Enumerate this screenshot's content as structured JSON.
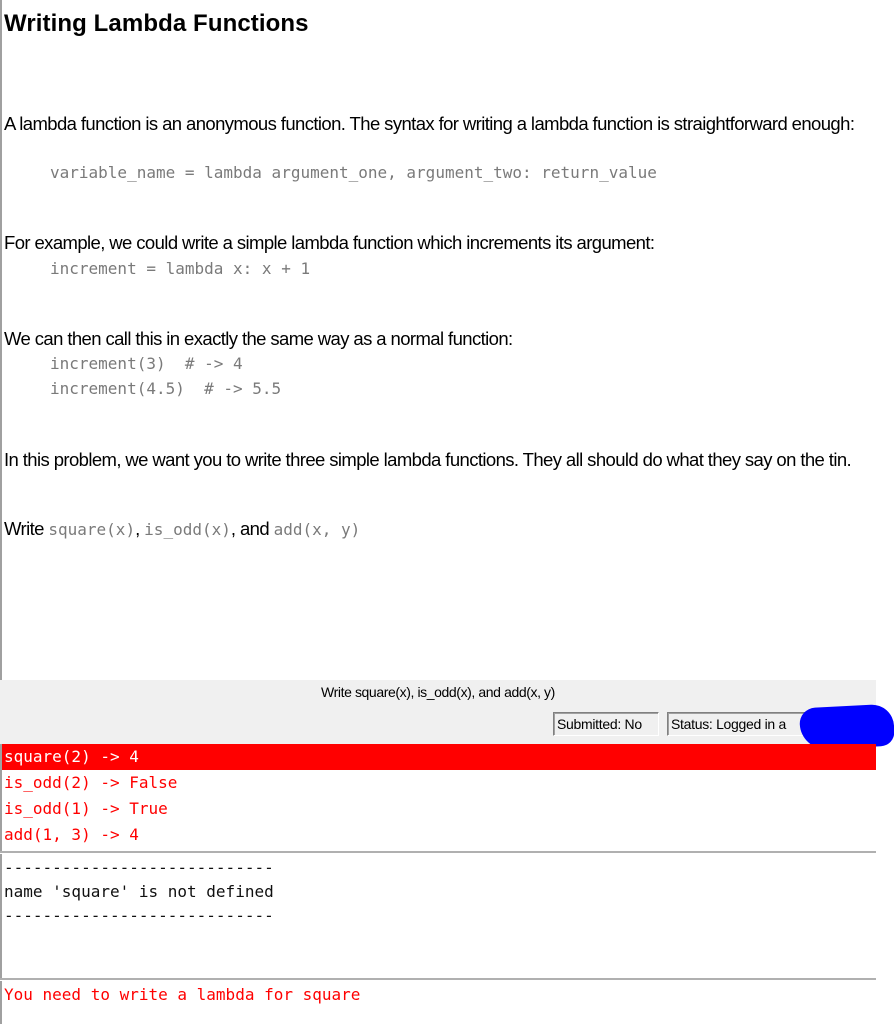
{
  "document": {
    "title": "Writing Lambda Functions",
    "paragraphs": {
      "intro": "A lambda function is an anonymous function. The syntax for writing a lambda function is straightforward enough:",
      "example": "For example, we could write a simple lambda function which increments its argument:",
      "call": "We can then call this in exactly the same way as a normal function:",
      "problem": "In this problem, we want you to write three simple lambda functions. They all should do what they say on the tin."
    },
    "code": {
      "syntax": "variable_name = lambda argument_one, argument_two: return_value",
      "increment_def": "increment = lambda x: x + 1",
      "call_1": "increment(3)  # -> 4",
      "call_2": "increment(4.5)  # -> 5.5"
    },
    "task": {
      "prefix": "Write ",
      "fn1": "square(x)",
      "sep1": ", ",
      "fn2": "is_odd(x)",
      "sep2": ", and ",
      "fn3": "add(x, y)"
    }
  },
  "panel": {
    "title": "Write square(x), is_odd(x), and add(x, y)",
    "submitted": "Submitted: No",
    "status": "Status: Logged in a"
  },
  "test_results": [
    {
      "text": "square(2) -> 4",
      "selected": true
    },
    {
      "text": "is_odd(2) -> False",
      "selected": false
    },
    {
      "text": "is_odd(1) -> True",
      "selected": false
    },
    {
      "text": "add(1, 3) -> 4",
      "selected": false
    }
  ],
  "output": {
    "divider": "----------------------------",
    "error": "name 'square' is not defined"
  },
  "feedback": "You need to write a lambda for square",
  "colors": {
    "fail": "#ff0000",
    "redaction": "#0000ff",
    "panel_bg": "#f0f0f0"
  }
}
